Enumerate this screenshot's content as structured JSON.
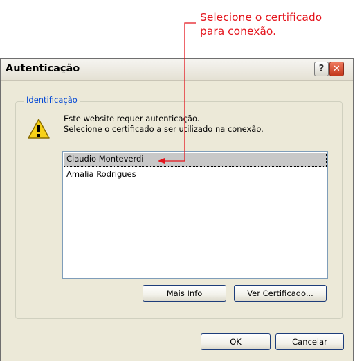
{
  "annotation": {
    "line1": "Selecione o certificado",
    "line2": "para conexão.",
    "color": "#e4141c"
  },
  "dialog": {
    "title": "Autenticação",
    "help_label": "?",
    "close_label": "✕"
  },
  "group": {
    "label": "Identificação",
    "message_line1": "Este website requer autenticação.",
    "message_line2": "Selecione o certificado a ser utilizado na conexão.",
    "icon": "warning-icon"
  },
  "certificates": {
    "items": [
      "Claudio Monteverdi",
      "Amalia Rodrigues"
    ],
    "selected": "Claudio Monteverdi"
  },
  "buttons": {
    "more_info": "Mais Info",
    "view_certificate": "Ver Certificado...",
    "ok": "OK",
    "cancel": "Cancelar"
  }
}
